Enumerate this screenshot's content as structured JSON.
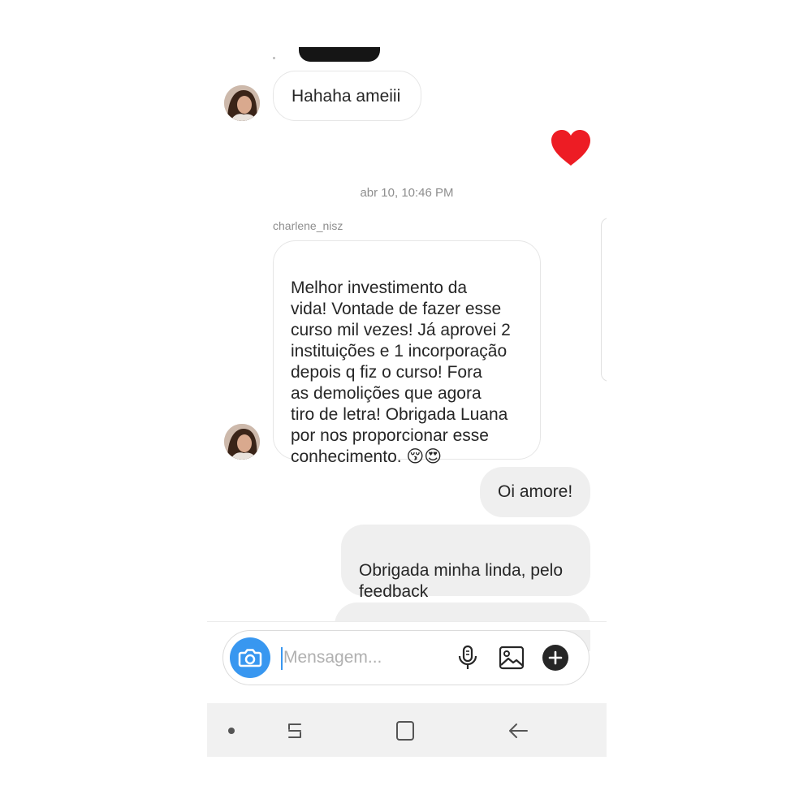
{
  "chat": {
    "messages": {
      "m1": {
        "text": "Hahaha ameiii"
      },
      "m3": {
        "text": "Melhor investimento da\nvida! Vontade de fazer esse\ncurso mil vezes! Já aprovei 2\ninstituições e 1 incorporação\ndepois q fiz o curso! Fora\nas demolições que agora\ntiro de letra! Obrigada Luana\npor nos proporcionar esse\nconhecimento. 😚😍"
      },
      "m4": {
        "text": "Oi amore!"
      },
      "m5": {
        "text": "Obrigada minha linda, pelo\nfeedback"
      }
    },
    "timestamp": "abr 10, 10:46 PM",
    "sender_username": "charlene_nisz",
    "heart_reaction": "heart-icon"
  },
  "composer": {
    "placeholder": "Mensagem...",
    "value": ""
  },
  "colors": {
    "accent": "#3897f0",
    "heart": "#ed1c24",
    "incoming_border": "#e6e6e6",
    "outgoing_bg": "#efefef",
    "nav_bg": "#f1f1f1"
  },
  "icons": [
    "camera-icon",
    "microphone-icon",
    "gallery-icon",
    "add-icon",
    "nav-dot-icon",
    "recents-icon",
    "home-icon",
    "back-icon"
  ]
}
